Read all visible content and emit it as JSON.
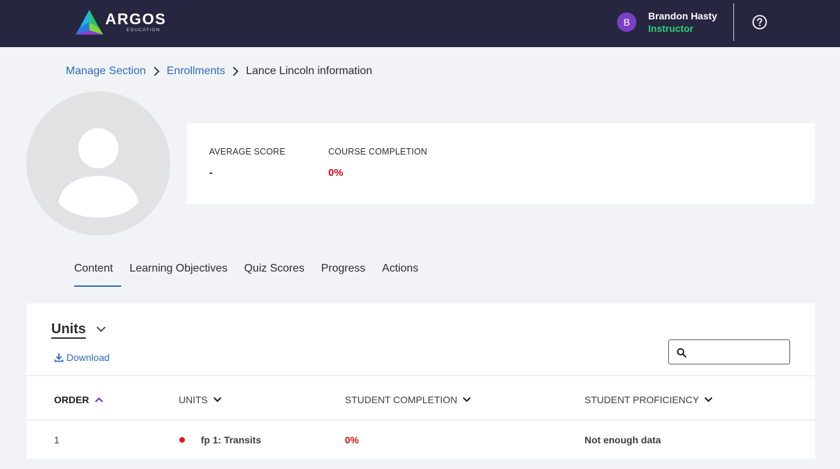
{
  "header": {
    "logo_name": "ARGOS",
    "logo_sub": "EDUCATION",
    "user": {
      "initial": "B",
      "name": "Brandon Hasty",
      "role": "Instructor"
    },
    "icons": {
      "help": "help-circle-icon"
    }
  },
  "breadcrumb": {
    "items": [
      "Manage Section",
      "Enrollments"
    ],
    "current": "Lance Lincoln information"
  },
  "stats": {
    "average_score": {
      "label": "AVERAGE SCORE",
      "value": "-"
    },
    "course_completion": {
      "label": "COURSE COMPLETION",
      "value": "0%"
    }
  },
  "tabs": [
    {
      "label": "Content",
      "active": true
    },
    {
      "label": "Learning Objectives",
      "active": false
    },
    {
      "label": "Quiz Scores",
      "active": false
    },
    {
      "label": "Progress",
      "active": false
    },
    {
      "label": "Actions",
      "active": false
    }
  ],
  "units": {
    "title": "Units",
    "download_label": "Download",
    "search": {
      "value": "",
      "placeholder": ""
    },
    "columns": [
      {
        "label": "ORDER",
        "sort": "ascending"
      },
      {
        "label": "UNITS",
        "sort": "none"
      },
      {
        "label": "STUDENT COMPLETION",
        "sort": "none"
      },
      {
        "label": "STUDENT PROFICIENCY",
        "sort": "none"
      }
    ],
    "rows": [
      {
        "order": "1",
        "unit": "fp 1: Transits",
        "completion": "0%",
        "proficiency": "Not enough data",
        "status_color": "#e3151b"
      }
    ]
  },
  "colors": {
    "topbar": "#262640",
    "link": "#2e6bbf",
    "alert_red": "#d80f12",
    "role_green": "#2fd07a",
    "avatar_purple": "#7c3fc4",
    "sort_active": "#6d28d9"
  }
}
